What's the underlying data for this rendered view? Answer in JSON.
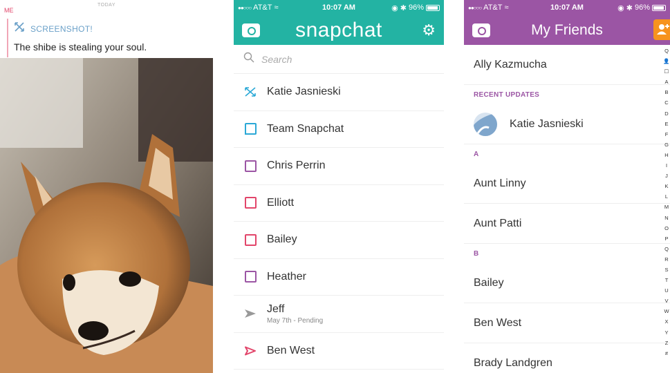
{
  "chat": {
    "day_label": "TODAY",
    "sender": "ME",
    "event_label": "SCREENSHOT!",
    "message": "The shibe is stealing your soul."
  },
  "snapchat": {
    "status": {
      "carrier": "AT&T",
      "time": "10:07 AM",
      "battery": "96%"
    },
    "title": "snapchat",
    "search_placeholder": "Search",
    "rows": [
      {
        "name": "Katie Jasnieski",
        "icon": "screenshot-icon",
        "color": "#2aa8d6"
      },
      {
        "name": "Team Snapchat",
        "icon": "chat-icon",
        "color": "#2aa8d6"
      },
      {
        "name": "Chris Perrin",
        "icon": "square-icon",
        "color": "#9b55a4"
      },
      {
        "name": "Elliott",
        "icon": "square-icon",
        "color": "#e2456a"
      },
      {
        "name": "Bailey",
        "icon": "square-icon",
        "color": "#e2456a"
      },
      {
        "name": "Heather",
        "icon": "square-icon",
        "color": "#9b55a4"
      },
      {
        "name": "Jeff",
        "sub": "May 7th - Pending",
        "icon": "arrow-icon",
        "color": "#999999"
      },
      {
        "name": "Ben West",
        "icon": "sent-arrow-icon",
        "color": "#e2456a"
      }
    ],
    "accent": "#23b3a3"
  },
  "friends": {
    "status": {
      "carrier": "AT&T",
      "time": "10:07 AM",
      "battery": "96%"
    },
    "title": "My Friends",
    "top_friend": "Ally Kazmucha",
    "recent_label": "RECENT UPDATES",
    "recent_friend": "Katie Jasnieski",
    "section_a": "A",
    "a_friends": [
      "Aunt Linny",
      "Aunt Patti"
    ],
    "section_b": "B",
    "b_friends": [
      "Bailey",
      "Ben West",
      "Brady Landgren"
    ],
    "index": [
      "Q",
      "👤",
      "☐",
      "A",
      "B",
      "C",
      "D",
      "E",
      "F",
      "G",
      "H",
      "I",
      "J",
      "K",
      "L",
      "M",
      "N",
      "O",
      "P",
      "Q",
      "R",
      "S",
      "T",
      "U",
      "V",
      "W",
      "X",
      "Y",
      "Z",
      "#"
    ],
    "accent": "#9b55a4"
  }
}
